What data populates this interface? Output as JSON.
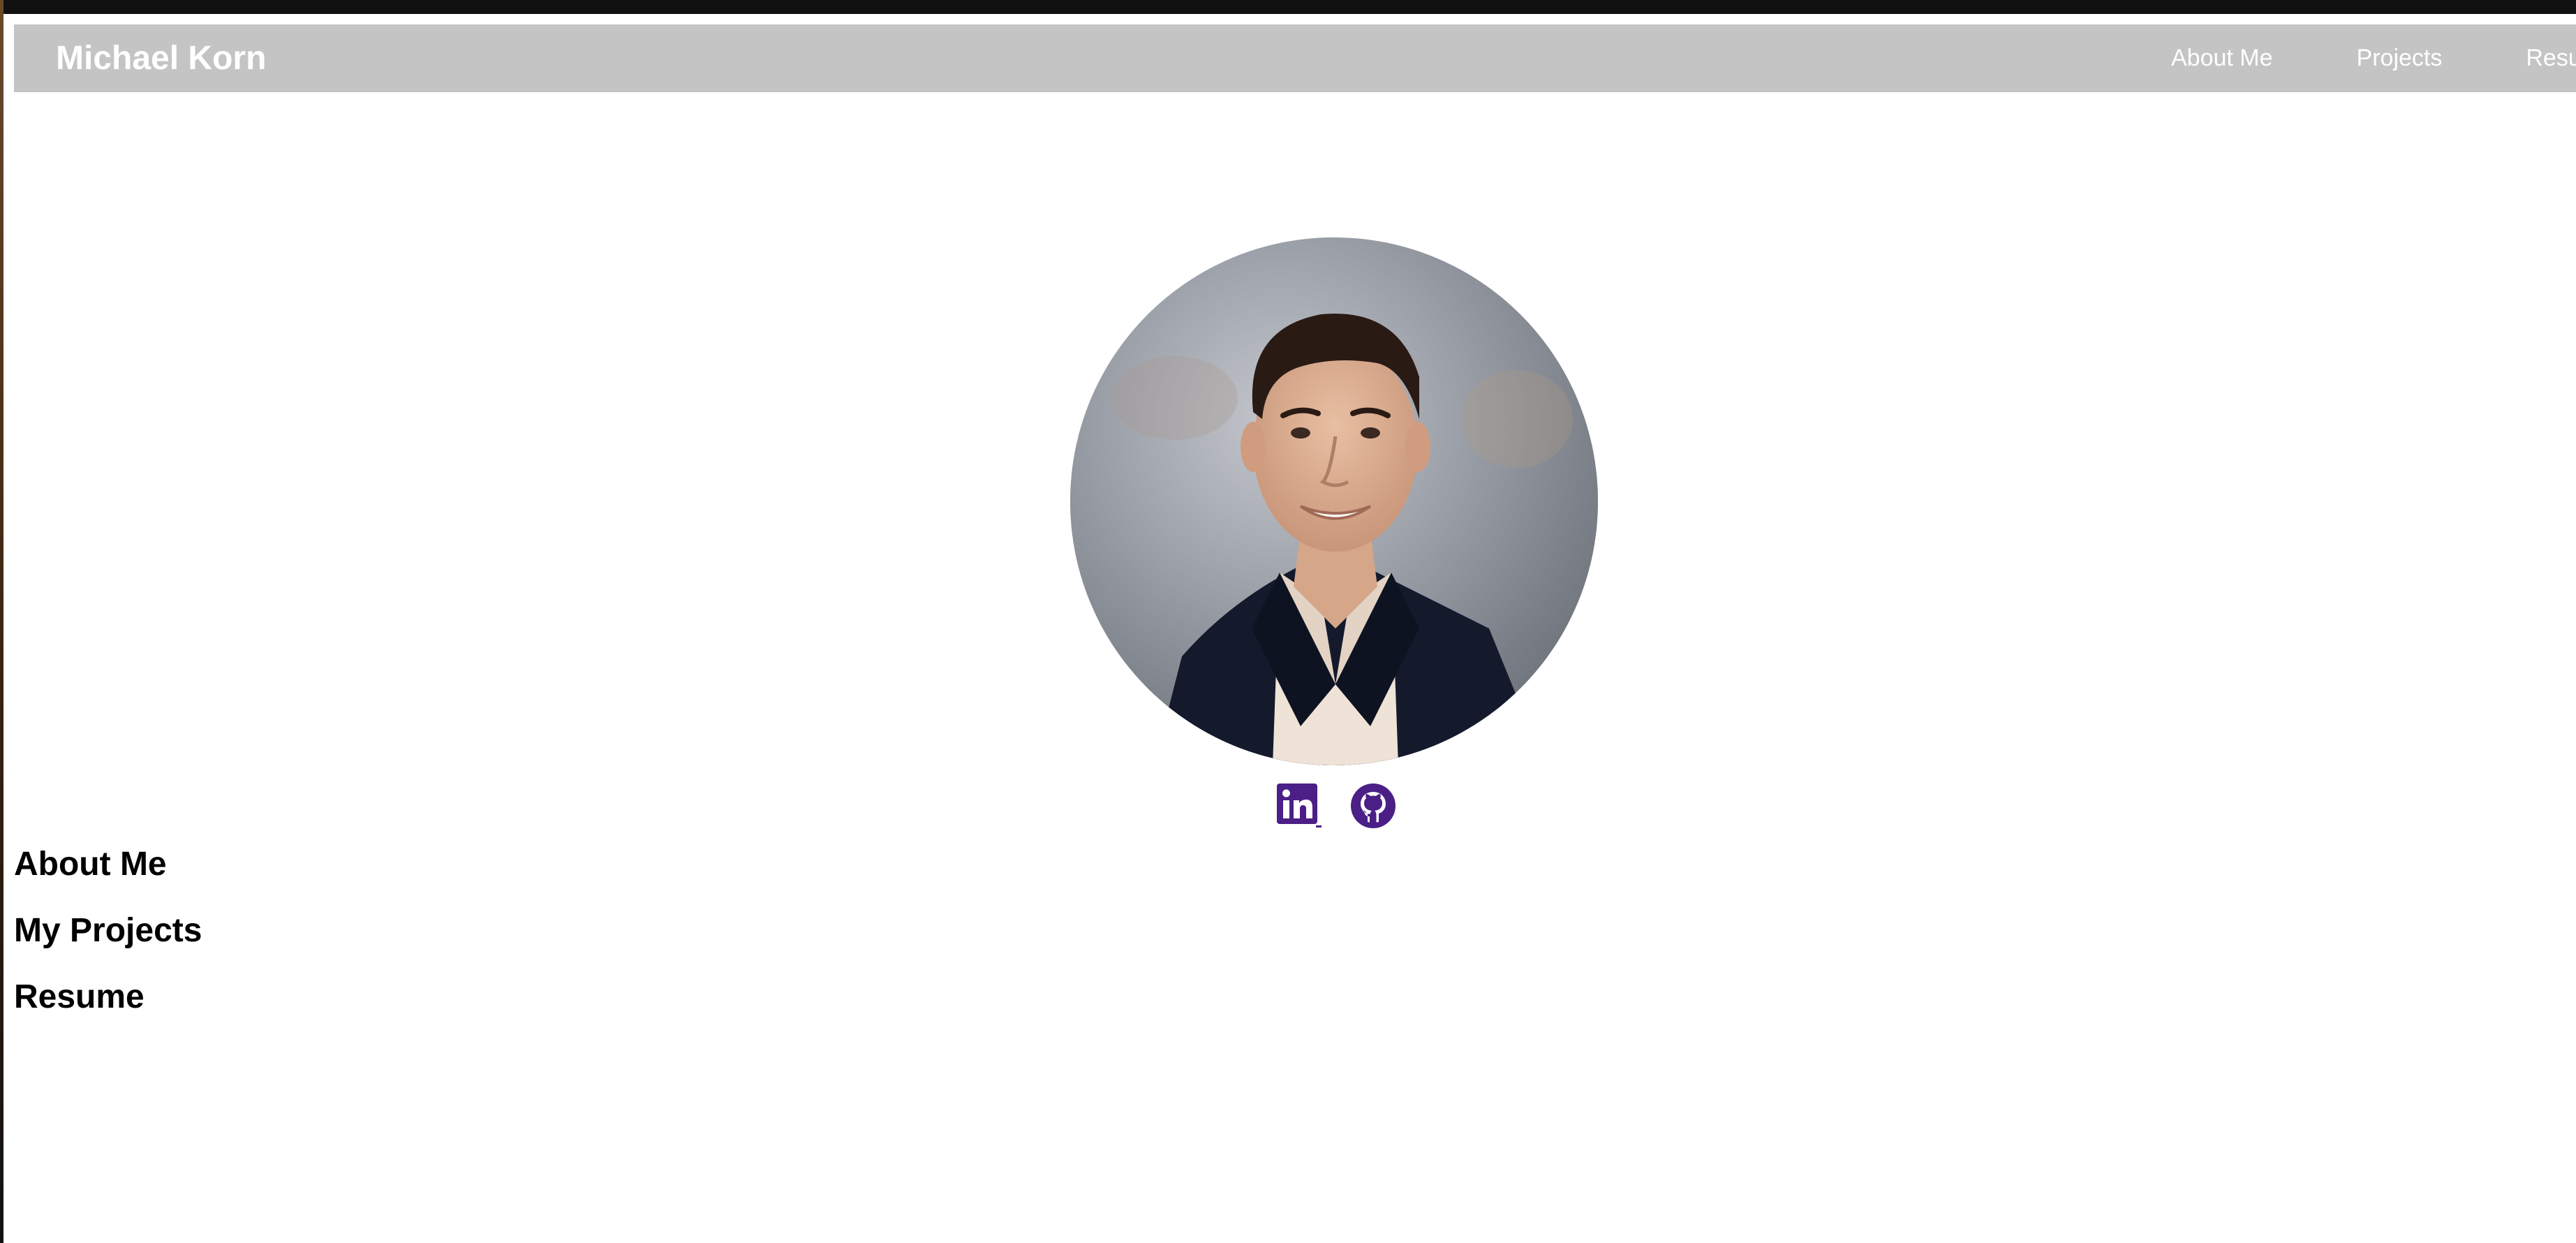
{
  "navbar": {
    "brand": "Michael Korn",
    "links": [
      {
        "label": "About Me"
      },
      {
        "label": "Projects"
      },
      {
        "label": "Resume"
      }
    ]
  },
  "profile": {
    "photo_icon": "profile-photo"
  },
  "socials": [
    {
      "icon": "linkedin-icon",
      "color": "#4b1f86"
    },
    {
      "icon": "github-icon",
      "color": "#4b1f86"
    }
  ],
  "sections": [
    {
      "heading": "About Me"
    },
    {
      "heading": "My Projects"
    },
    {
      "heading": "Resume"
    }
  ],
  "colors": {
    "navbar_bg": "#c4c4c4",
    "nav_text": "#ffffff",
    "accent": "#4b1f86"
  }
}
